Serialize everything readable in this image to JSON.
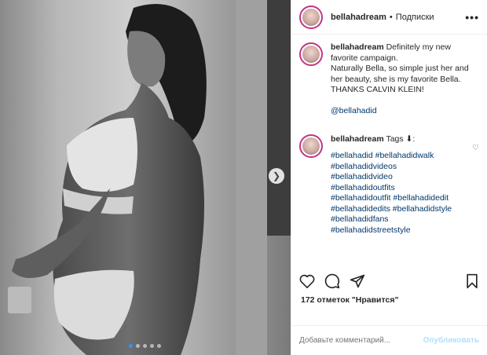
{
  "post": {
    "author": "bellahadream",
    "follow_status": "Подписки",
    "separator": "•",
    "more_icon": "•••"
  },
  "carousel": {
    "dots": 5,
    "active_index": 0
  },
  "caption": {
    "username": "bellahadream",
    "lines": [
      "Definitely my new",
      "favorite campaign.",
      "Naturally Bella, so simple just her and",
      "her beauty, she is my favorite Bella.",
      "THANKS CALVIN KLEIN!"
    ],
    "mention": "@bellahadid"
  },
  "tags_comment": {
    "username": "bellahadream",
    "text": "Tags ⬇:",
    "tags": [
      "#bellahadid #bellahadidwalk",
      "#bellahadidvideos",
      "#bellahadidvideo",
      "#bellahadidoutfits",
      "#bellahadidoutfit #bellahadidedit",
      "#bellahadidedits #bellahadidstyle",
      "#bellahadidfans",
      "#bellahadidstreetstyle"
    ]
  },
  "likes": "172 отметок \"Нравится\"",
  "add_comment": {
    "placeholder": "Добавьте комментарий...",
    "post_label": "Опубликовать"
  },
  "colors": {
    "link": "#00376b",
    "post_disabled": "#b2dffc",
    "story_ring": "#c13584",
    "dot_active": "#2f95f5"
  },
  "icons": {
    "like": "heart-icon",
    "comment": "comment-icon",
    "share": "share-icon",
    "save": "bookmark-icon",
    "next": "chevron-right-icon",
    "small_like": "heart-icon"
  }
}
